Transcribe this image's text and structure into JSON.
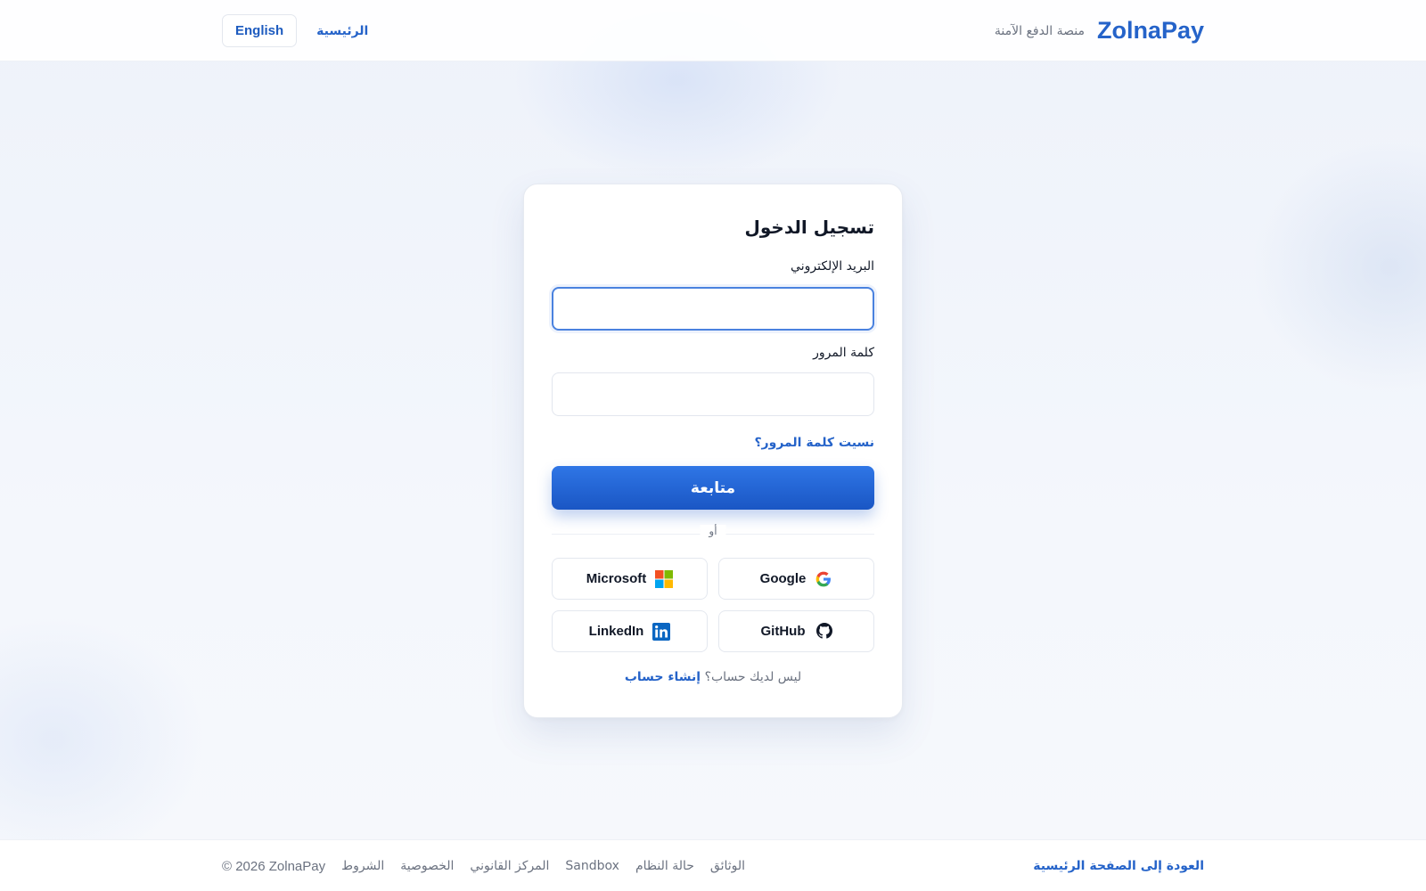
{
  "header": {
    "brand_name": "ZolnaPay",
    "brand_tagline": "منصة الدفع الآمنة",
    "nav_home": "الرئيسية",
    "language_button": "English"
  },
  "login": {
    "title": "تسجيل الدخول",
    "email_label": "البريد الإلكتروني",
    "email_value": "",
    "password_label": "كلمة المرور",
    "password_value": "",
    "forgot_password": "نسيت كلمة المرور؟",
    "continue_button": "متابعة",
    "divider_text": "أو",
    "social": [
      {
        "label": "Google",
        "icon": "google-icon"
      },
      {
        "label": "Microsoft",
        "icon": "microsoft-icon"
      },
      {
        "label": "GitHub",
        "icon": "github-icon"
      },
      {
        "label": "LinkedIn",
        "icon": "linkedin-icon"
      }
    ],
    "no_account_text": "ليس لديك حساب؟",
    "create_account": "إنشاء حساب"
  },
  "footer": {
    "back_home": "العودة إلى الصفحة الرئيسية",
    "links": [
      "الوثائق",
      "حالة النظام",
      "Sandbox",
      "المركز القانوني",
      "الخصوصية",
      "الشروط"
    ],
    "copyright": "© 2026 ZolnaPay"
  },
  "colors": {
    "accent": "#2563c9",
    "primary_button": "#1f5fd0",
    "focus_border": "#4a82df"
  }
}
